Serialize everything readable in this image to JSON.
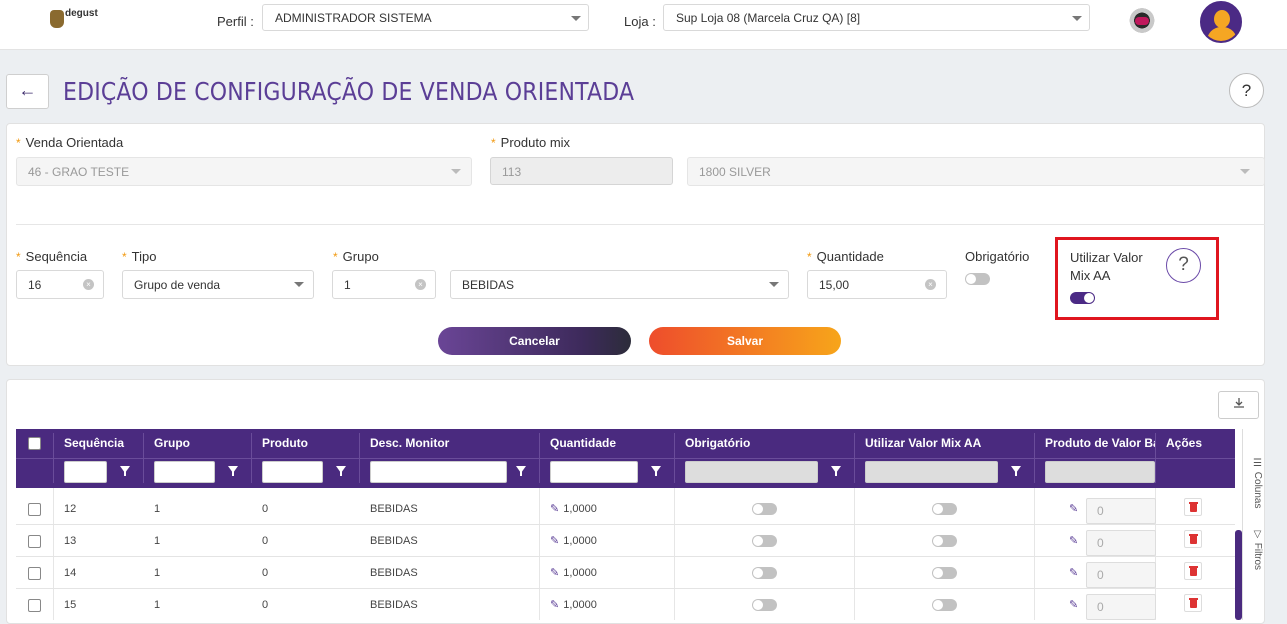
{
  "header": {
    "logo_text": "degust",
    "perfil_label": "Perfil :",
    "perfil_value": "ADMINISTRADOR SISTEMA",
    "loja_label": "Loja :",
    "loja_value": "Sup Loja 08 (Marcela Cruz QA) [8]"
  },
  "title_bar": {
    "back_icon": "arrow-left-icon",
    "title": "EDIÇÃO DE CONFIGURAÇÃO DE VENDA ORIENTADA",
    "help_label": "?"
  },
  "form": {
    "venda_orientada": {
      "label": "Venda Orientada",
      "value": "46 - GRAO TESTE"
    },
    "produto_mix": {
      "label": "Produto mix",
      "code": "113",
      "name": "1800 SILVER"
    },
    "sequencia": {
      "label": "Sequência",
      "value": "16"
    },
    "tipo": {
      "label": "Tipo",
      "value": "Grupo de venda"
    },
    "grupo": {
      "label": "Grupo",
      "code": "1",
      "name": "BEBIDAS"
    },
    "quantidade": {
      "label": "Quantidade",
      "value": "15,00"
    },
    "obrigatorio": {
      "label": "Obrigatório",
      "on": false
    },
    "utilizar_valor_mix": {
      "label_line1": "Utilizar Valor",
      "label_line2": "Mix AA",
      "on": true,
      "help_label": "?"
    },
    "cancel_label": "Cancelar",
    "save_label": "Salvar"
  },
  "grid": {
    "download_icon": "download-icon",
    "columns": [
      "Sequência",
      "Grupo",
      "Produto",
      "Desc. Monitor",
      "Quantidade",
      "Obrigatório",
      "Utilizar Valor Mix AA",
      "Produto de Valor Base",
      "Ações"
    ],
    "rows": [
      {
        "sequencia": "12",
        "grupo": "1",
        "produto": "0",
        "desc": "BEBIDAS",
        "quantidade": "1,0000",
        "obrigatorio": false,
        "utilizar": false,
        "produto_base": "0"
      },
      {
        "sequencia": "13",
        "grupo": "1",
        "produto": "0",
        "desc": "BEBIDAS",
        "quantidade": "1,0000",
        "obrigatorio": false,
        "utilizar": false,
        "produto_base": "0"
      },
      {
        "sequencia": "14",
        "grupo": "1",
        "produto": "0",
        "desc": "BEBIDAS",
        "quantidade": "1,0000",
        "obrigatorio": false,
        "utilizar": false,
        "produto_base": "0"
      },
      {
        "sequencia": "15",
        "grupo": "1",
        "produto": "0",
        "desc": "BEBIDAS",
        "quantidade": "1,0000",
        "obrigatorio": false,
        "utilizar": false,
        "produto_base": "0"
      }
    ],
    "side_tabs": [
      "Colunas",
      "Filtros"
    ]
  },
  "colors": {
    "primary": "#4a2a7f",
    "accent": "#f29a12",
    "highlight": "#e0161f"
  }
}
